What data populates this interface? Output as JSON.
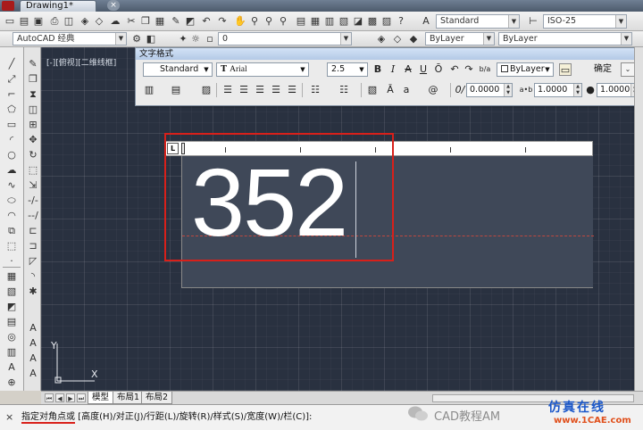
{
  "window": {
    "doc_tab": "Drawing1*",
    "doc_tab_close": "×"
  },
  "toolbar1": {
    "text_style": "Standard",
    "dim_style": "ISO-25"
  },
  "toolbar2": {
    "workspace": "AutoCAD 经典",
    "layer": "0",
    "color": "ByLayer",
    "linetype": "ByLayer"
  },
  "viewport": {
    "label": "[-][俯视][二维线框]"
  },
  "text_format": {
    "title": "文字格式",
    "style": "Standard",
    "font": "Arial",
    "height": "2.5",
    "bold": "B",
    "italic": "I",
    "strike": "A",
    "underline": "U",
    "overline": "Ō",
    "undo": "↶",
    "redo": "↷",
    "stack": "b/a",
    "color": "ByLayer",
    "ok": "确定",
    "options": "⌄",
    "insert_field": "@",
    "oblique": "0.0000",
    "tracking": "1.0000",
    "width_factor": "1.0000"
  },
  "editor": {
    "ruler_tab": "L",
    "mtext_value": "352"
  },
  "ucs": {
    "y": "Y",
    "x": "X"
  },
  "layout_tabs": [
    "模型",
    "布局1",
    "布局2"
  ],
  "command": {
    "close": "×",
    "prompt": "指定对角点或",
    "options": " [高度(H)/对正(J)/行距(L)/旋转(R)/样式(S)/宽度(W)/栏(C)]:"
  },
  "watermark": {
    "brand": "CAD教程AM",
    "site_cn": "仿真在线",
    "site_url": "www.1CAE.com"
  }
}
